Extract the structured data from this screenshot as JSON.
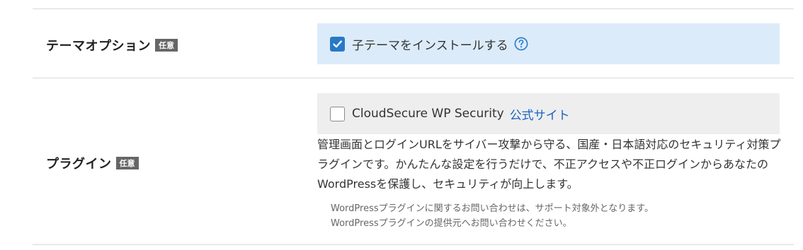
{
  "theme_option": {
    "label": "テーマオプション",
    "badge": "任意",
    "child_theme": {
      "label": "子テーマをインストールする",
      "checked": true,
      "help_icon": "question-circle-icon"
    }
  },
  "plugin": {
    "label": "プラグイン",
    "badge": "任意",
    "cloudsecure": {
      "label": "CloudSecure WP Security",
      "checked": false,
      "link_label": "公式サイト"
    },
    "description": "管理画面とログインURLをサイバー攻撃から守る、国産・日本語対応のセキュリティ対策プラグインです。かんたんな設定を行うだけで、不正アクセスや不正ログインからあなたのWordPressを保護し、セキュリティが向上します。",
    "notes": [
      "WordPressプラグインに関するお問い合わせは、サポート対象外となります。",
      "WordPressプラグインの提供元へお問い合わせください。"
    ]
  },
  "colors": {
    "accent": "#2979c7",
    "link": "#1a62c4",
    "option_bg_blue": "#dcebfa",
    "option_bg_gray": "#eeeeee",
    "badge_bg": "#666666"
  }
}
